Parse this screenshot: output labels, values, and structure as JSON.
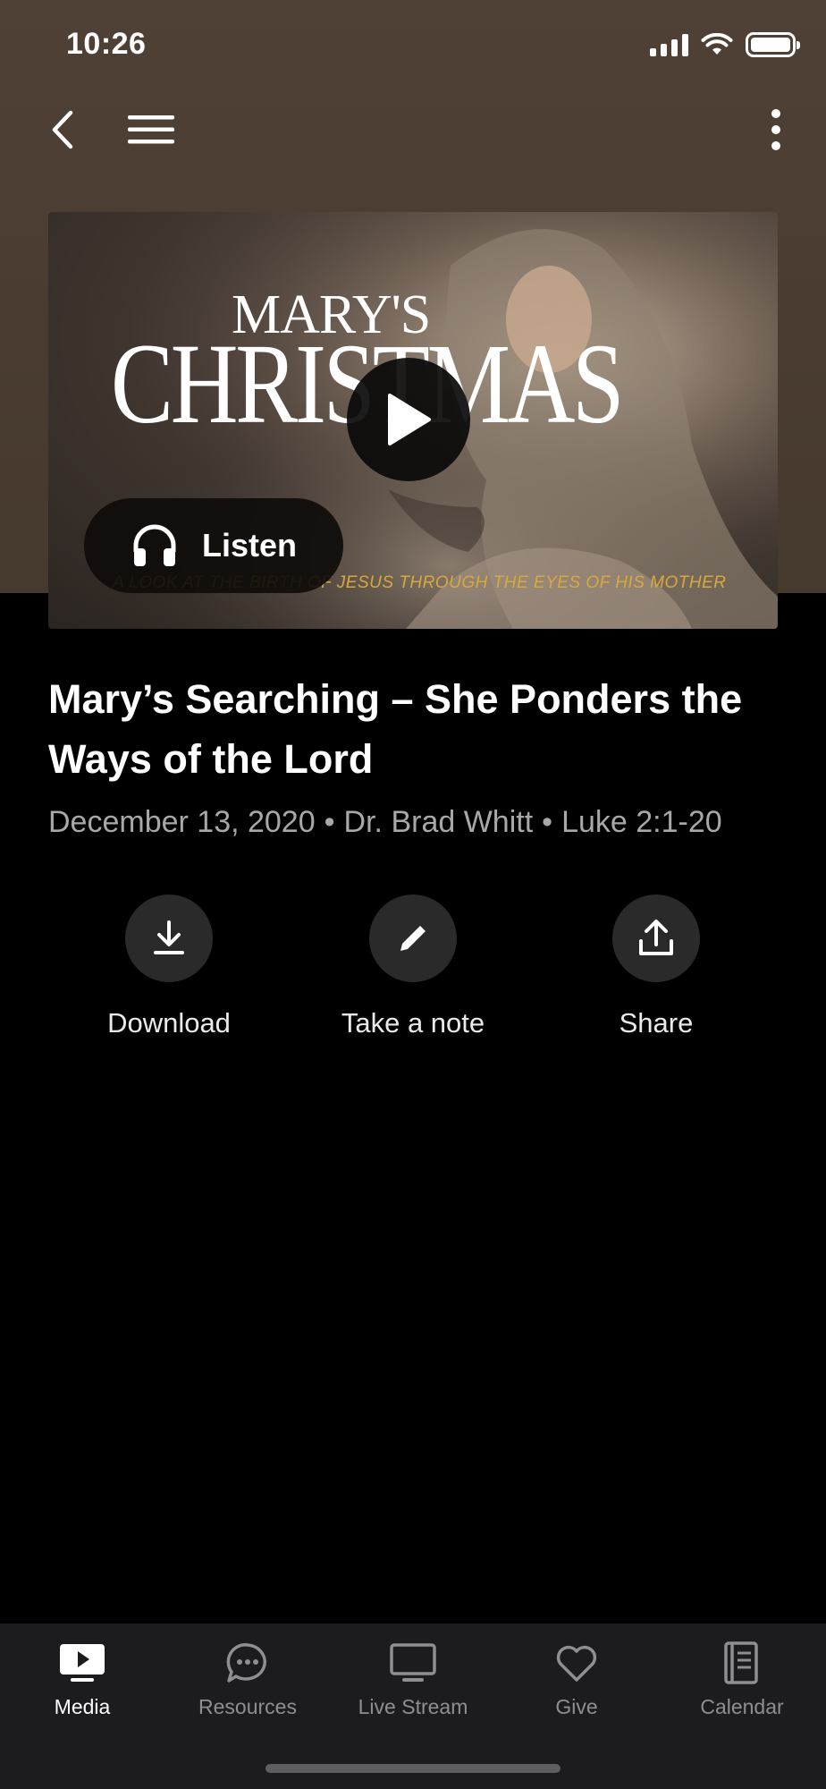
{
  "status_bar": {
    "time": "10:26"
  },
  "nav": {
    "back_icon": "chevron-left-icon",
    "menu_icon": "hamburger-menu-icon",
    "more_icon": "vertical-ellipsis-icon"
  },
  "hero": {
    "title_small": "MARY'S",
    "title_big": "CHRISTMAS",
    "tagline": "A LOOK AT THE BIRTH OF JESUS THROUGH THE EYES OF HIS MOTHER",
    "play_icon": "play-icon",
    "listen_label": "Listen",
    "listen_icon": "headphones-icon"
  },
  "sermon": {
    "title": "Mary’s Searching – She Ponders the Ways of the Lord",
    "date": "December 13, 2020",
    "speaker": "Dr. Brad Whitt",
    "scripture": "Luke 2:1-20",
    "separator": "•"
  },
  "actions": [
    {
      "label": "Download",
      "icon": "download-icon"
    },
    {
      "label": "Take a note",
      "icon": "pencil-icon"
    },
    {
      "label": "Share",
      "icon": "share-icon"
    }
  ],
  "tabs": [
    {
      "label": "Media",
      "icon": "media-play-icon",
      "active": true
    },
    {
      "label": "Resources",
      "icon": "chat-bubble-icon",
      "active": false
    },
    {
      "label": "Live Stream",
      "icon": "monitor-icon",
      "active": false
    },
    {
      "label": "Give",
      "icon": "heart-icon",
      "active": false
    },
    {
      "label": "Calendar",
      "icon": "book-icon",
      "active": false
    }
  ],
  "colors": {
    "header_bg": "#4a3c30",
    "tab_bar_bg": "#1c1c1e",
    "action_circle": "#2a2a2a",
    "meta_text": "#a8a8a8",
    "tagline_gold": "#d8a93a"
  }
}
